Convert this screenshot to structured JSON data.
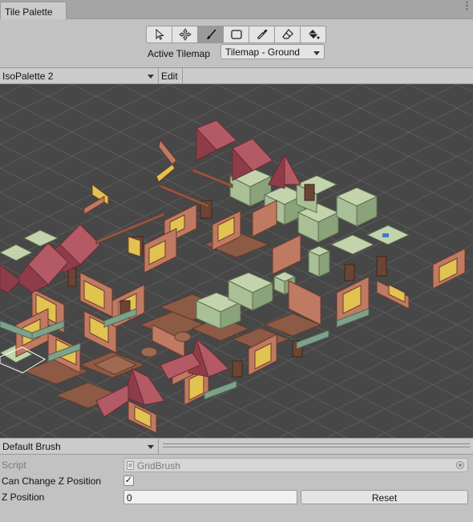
{
  "window": {
    "tab_title": "Tile Palette"
  },
  "tools": [
    {
      "name": "select-tool",
      "icon": "arrow-cursor-icon"
    },
    {
      "name": "move-tool",
      "icon": "move-arrows-icon"
    },
    {
      "name": "paint-tool",
      "icon": "brush-icon",
      "active": true
    },
    {
      "name": "box-fill-tool",
      "icon": "rectangle-icon"
    },
    {
      "name": "picker-tool",
      "icon": "eyedropper-icon"
    },
    {
      "name": "erase-tool",
      "icon": "eraser-icon"
    },
    {
      "name": "flood-fill-tool",
      "icon": "paint-bucket-icon"
    }
  ],
  "active_tilemap": {
    "label": "Active Tilemap",
    "value": "Tilemap - Ground"
  },
  "palette": {
    "selected": "IsoPalette 2",
    "edit_label": "Edit"
  },
  "brush": {
    "selected": "Default Brush"
  },
  "inspector": {
    "script_label": "Script",
    "script_value": "GridBrush",
    "can_change_z_label": "Can Change Z Position",
    "can_change_z_checked": "✓",
    "z_position_label": "Z Position",
    "z_position_value": "0",
    "reset_label": "Reset"
  },
  "colors": {
    "canvas_bg": "#474747",
    "roof": "#a8505a",
    "stone": "#a9bf96",
    "wall": "#c07a62",
    "window": "#e2c250",
    "floor": "#8c5a45"
  }
}
